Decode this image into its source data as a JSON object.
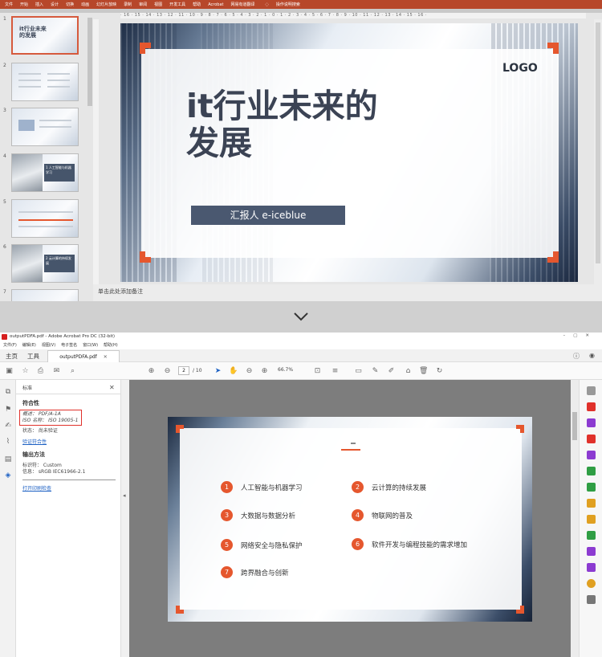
{
  "ppt": {
    "ribbon_tabs": [
      "文件",
      "开始",
      "插入",
      "设计",
      "切换",
      "动画",
      "幻灯片放映",
      "录制",
      "审阅",
      "视图",
      "开发工具",
      "帮助",
      "Acrobat",
      "网易有道翻译"
    ],
    "tell_me": "操作说明搜索",
    "ruler_text": "· 16 · 15 · 14 · 13 · 12 · 11 · 10 · 9 · 8 · 7 · 6 · 5 · 4 · 3 · 2 · 1 · 0 · 1 · 2 · 3 · 4 · 5 · 6 · 7 · 8 · 9 · 10 · 11 · 12 · 13 · 14 · 15 · 16 ·",
    "thumbnails": [
      {
        "num": "1",
        "title": "it行业未来的发展"
      },
      {
        "num": "2"
      },
      {
        "num": "3"
      },
      {
        "num": "4",
        "label": "1 人工智能与机器学习"
      },
      {
        "num": "5"
      },
      {
        "num": "6",
        "label": "2 云计算的持续发展"
      },
      {
        "num": "7"
      }
    ],
    "slide": {
      "title_line1": "it行业未来的",
      "title_line2": "发展",
      "logo": "LOGO",
      "presenter": "汇报人 e-iceblue"
    },
    "notes_placeholder": "单击此处添加备注"
  },
  "acrobat": {
    "window_title": "outputPDFA.pdf - Adobe Acrobat Pro DC (32-bit)",
    "menu": [
      "文件(F)",
      "编辑(E)",
      "视图(V)",
      "电子签名",
      "窗口(W)",
      "帮助(H)"
    ],
    "tabs": {
      "home": "主页",
      "tools": "工具",
      "document": "outputPDFA.pdf"
    },
    "page_current": "2",
    "page_total": "/ 10",
    "zoom": "66.7%",
    "standards_panel": {
      "title": "标准",
      "compliance_heading": "符合性",
      "profile_line": "概述：  PDF/A-1A",
      "iso_line": "ISO 名称：  ISO 19005-1",
      "status_line": "状态：  尚未验证",
      "verify_link": "验证符合性",
      "output_heading": "输出方法",
      "output_id": "标识符：  Custom",
      "output_info": "信息：  sRGB IEC61966-2.1",
      "print_link": "打开印刷检查"
    },
    "page_items": [
      {
        "n": "1",
        "text": "人工智能与机器学习"
      },
      {
        "n": "2",
        "text": "云计算的持续发展"
      },
      {
        "n": "3",
        "text": "大数据与数据分析"
      },
      {
        "n": "4",
        "text": "物联网的普及"
      },
      {
        "n": "5",
        "text": "网络安全与隐私保护"
      },
      {
        "n": "6",
        "text": "软件开发与编程技能的需求增加"
      },
      {
        "n": "7",
        "text": "跨界融合与创新"
      }
    ]
  },
  "colors": {
    "ppt_accent": "#b7472a",
    "slide_accent": "#e5572e",
    "dark_slate": "#4a5870",
    "link": "#1f62c4",
    "highlight_box": "#e0312b"
  }
}
